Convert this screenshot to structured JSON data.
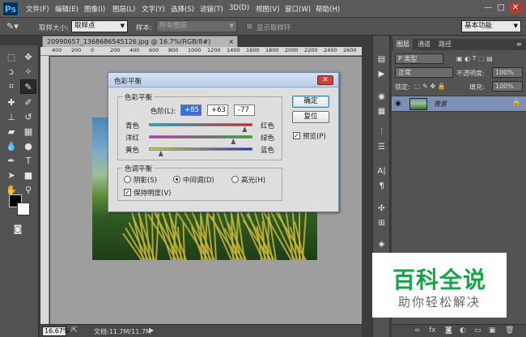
{
  "app": {
    "logo": "Ps",
    "menu": [
      "文件(F)",
      "编辑(E)",
      "图像(I)",
      "图层(L)",
      "文字(Y)",
      "选择(S)",
      "滤镜(T)",
      "3D(D)",
      "视图(V)",
      "窗口(W)",
      "帮助(H)"
    ],
    "window_controls": [
      "—",
      "□",
      "✕"
    ]
  },
  "options_bar": {
    "sample_size_label": "取样大小:",
    "sample_size_value": "取样点",
    "sample_label": "样本:",
    "sample_value": "所有图层",
    "show_ring_label": "显示取样环",
    "workspace_value": "基本功能"
  },
  "document": {
    "tab_title": "20990657_1368686545126.jpg @ 16.7%(RGB/8#)",
    "tab_close": "×",
    "ruler_ticks": [
      "400",
      "200",
      "0",
      "200",
      "400",
      "600",
      "800",
      "1000",
      "1200",
      "1400",
      "1600",
      "1800",
      "2000",
      "2200",
      "2400",
      "2600"
    ],
    "zoom": "16.67%",
    "doc_info": "文档:11.7M/11.7M"
  },
  "dialog": {
    "title": "色彩平衡",
    "close": "✕",
    "balance_group": "色彩平衡",
    "levels_label": "色阶(L):",
    "levels": [
      "+85",
      "+63",
      "-77"
    ],
    "sliders": [
      {
        "left": "青色",
        "right": "红色",
        "value": 85,
        "colors": [
          "#00b4c8",
          "#d92020"
        ]
      },
      {
        "left": "洋红",
        "right": "绿色",
        "value": 63,
        "colors": [
          "#d020c8",
          "#20b020"
        ]
      },
      {
        "left": "黄色",
        "right": "蓝色",
        "value": -77,
        "colors": [
          "#d8d020",
          "#2030d0"
        ]
      }
    ],
    "ok": "确定",
    "reset": "复位",
    "preview_label": "预览(P)",
    "preview_checked": true,
    "tone_group": "色调平衡",
    "tones": [
      {
        "label": "阴影(S)",
        "selected": false
      },
      {
        "label": "中间调(D)",
        "selected": true
      },
      {
        "label": "高光(H)",
        "selected": false
      }
    ],
    "preserve_label": "保持明度(V)",
    "preserve_checked": true
  },
  "layers_panel": {
    "tabs": [
      "图层",
      "通道",
      "路径"
    ],
    "kind_value": "P 类型",
    "blend_value": "正常",
    "opacity_label": "不透明度:",
    "opacity_value": "100%",
    "lock_label": "锁定:",
    "fill_label": "填充:",
    "fill_value": "100%",
    "layer_name": "背景",
    "footer_icons": [
      "∞",
      "fx",
      "◙",
      "◐",
      "▭",
      "▣",
      "🗑"
    ]
  },
  "watermark": {
    "title": "百科全说",
    "subtitle": "助你轻松解决"
  }
}
